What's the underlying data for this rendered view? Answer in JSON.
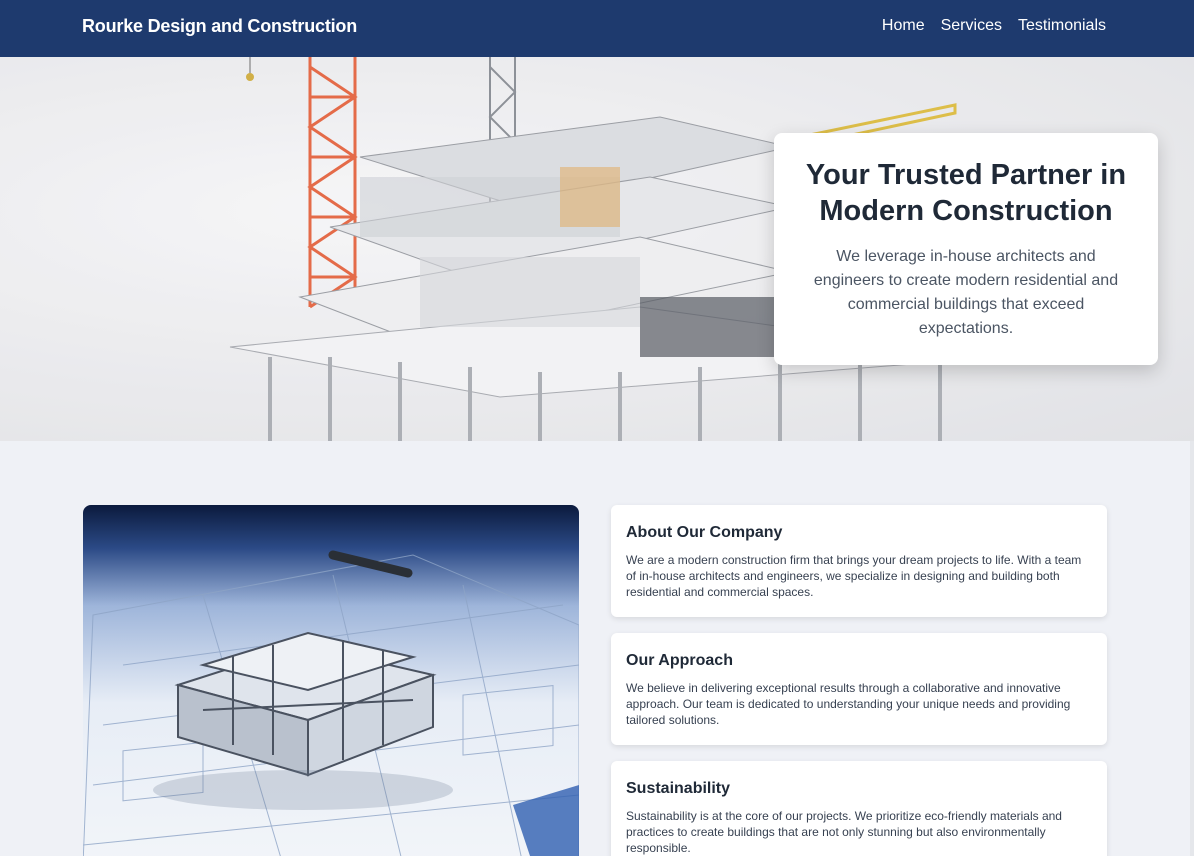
{
  "header": {
    "brand": "Rourke Design and Construction",
    "nav": [
      "Home",
      "Services",
      "Testimonials"
    ]
  },
  "hero": {
    "title": "Your Trusted Partner in Modern Construction",
    "text": "We leverage in-house architects and engineers to create modern residential and commercial buildings that exceed expectations."
  },
  "cards": [
    {
      "title": "About Our Company",
      "text": "We are a modern construction firm that brings your dream projects to life. With a team of in-house architects and engineers, we specialize in designing and building both residential and commercial spaces."
    },
    {
      "title": "Our Approach",
      "text": "We believe in delivering exceptional results through a collaborative and innovative approach. Our team is dedicated to understanding your unique needs and providing tailored solutions."
    },
    {
      "title": "Sustainability",
      "text": "Sustainability is at the core of our projects. We prioritize eco-friendly materials and practices to create buildings that are not only stunning but also environmentally responsible."
    }
  ],
  "colors": {
    "header_bg": "#1e3a6e",
    "page_bg": "#eff1f6",
    "crane": "#e0522a"
  }
}
